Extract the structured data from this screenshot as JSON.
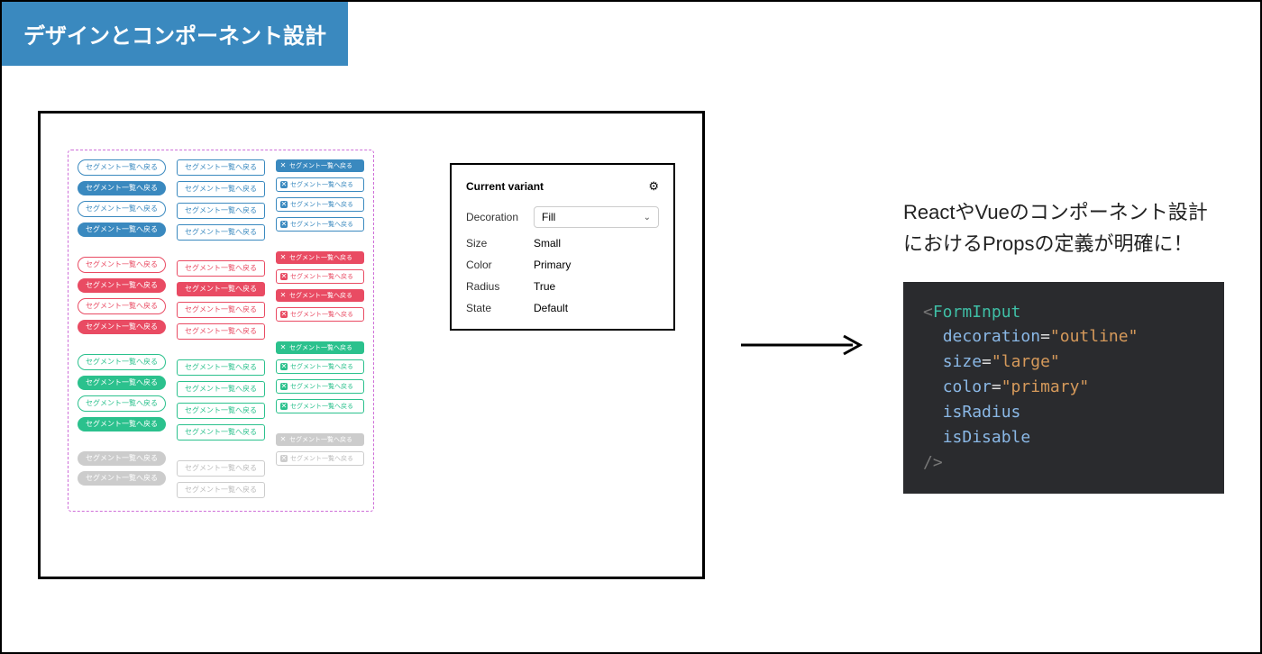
{
  "title": "デザインとコンポーネント設計",
  "button_label": "セグメント一覧へ戻る",
  "panel": {
    "heading": "Current variant",
    "props": {
      "decoration": {
        "label": "Decoration",
        "value": "Fill"
      },
      "size": {
        "label": "Size",
        "value": "Small"
      },
      "color": {
        "label": "Color",
        "value": "Primary"
      },
      "radius": {
        "label": "Radius",
        "value": "True"
      },
      "state": {
        "label": "State",
        "value": "Default"
      }
    }
  },
  "description": "ReactやVueのコンポーネント設計におけるPropsの定義が明確に！",
  "code": {
    "tag_open": "<",
    "component": "FormInput",
    "attrs": [
      {
        "name": "decoration",
        "eq": "=",
        "value": "\"outline\""
      },
      {
        "name": "size",
        "eq": "=",
        "value": "\"large\""
      },
      {
        "name": "color",
        "eq": "=",
        "value": "\"primary\""
      },
      {
        "name": "isRadius"
      },
      {
        "name": "isDisable"
      }
    ],
    "tag_close": "/>"
  }
}
